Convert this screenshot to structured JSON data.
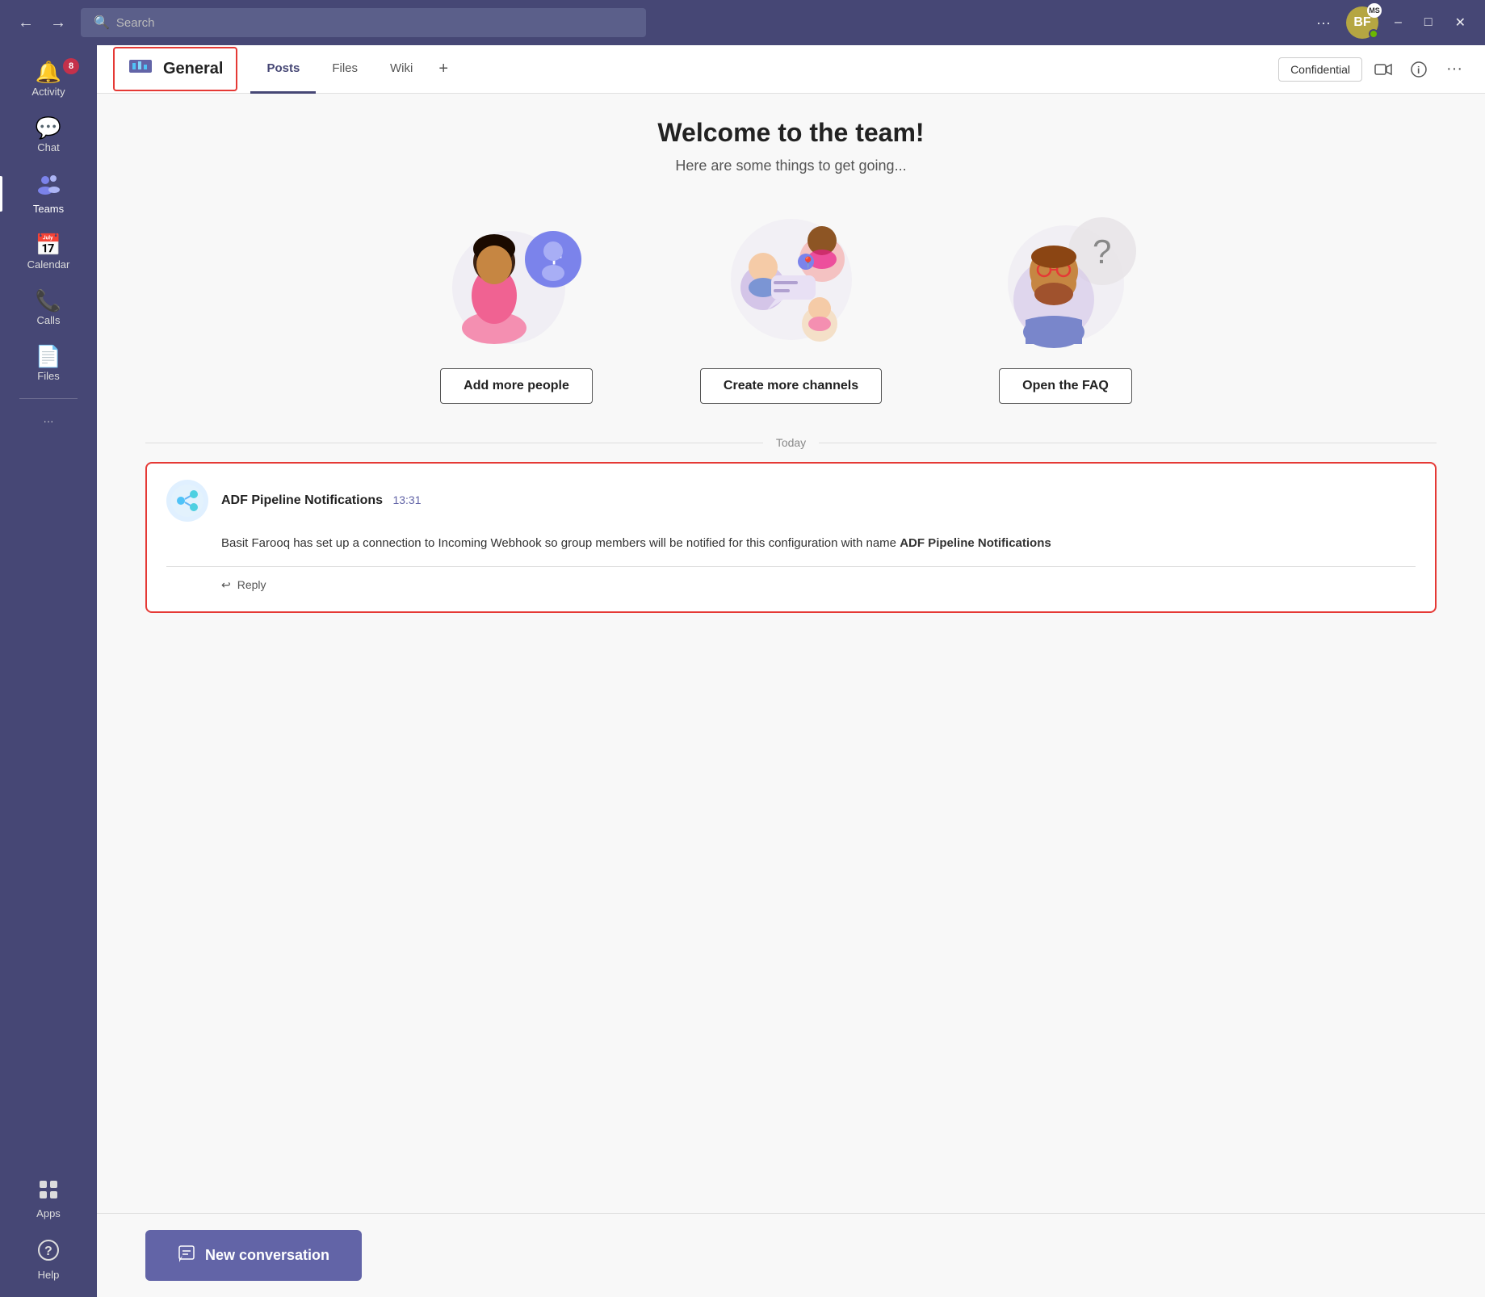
{
  "titleBar": {
    "search_placeholder": "Search",
    "back_label": "←",
    "forward_label": "→",
    "more_label": "···",
    "avatar_initials": "BF",
    "ms_badge": "MS",
    "minimize_label": "–",
    "maximize_label": "□",
    "close_label": "✕"
  },
  "sidebar": {
    "items": [
      {
        "id": "activity",
        "label": "Activity",
        "icon": "🔔",
        "badge": "8",
        "active": false
      },
      {
        "id": "chat",
        "label": "Chat",
        "icon": "💬",
        "badge": null,
        "active": false
      },
      {
        "id": "teams",
        "label": "Teams",
        "icon": "👥",
        "badge": null,
        "active": true
      },
      {
        "id": "calendar",
        "label": "Calendar",
        "icon": "📅",
        "badge": null,
        "active": false
      },
      {
        "id": "calls",
        "label": "Calls",
        "icon": "📞",
        "badge": null,
        "active": false
      },
      {
        "id": "files",
        "label": "Files",
        "icon": "📄",
        "badge": null,
        "active": false
      },
      {
        "id": "more",
        "label": "···",
        "icon": "···",
        "badge": null,
        "active": false
      }
    ],
    "bottom_items": [
      {
        "id": "apps",
        "label": "Apps",
        "icon": "⊞"
      },
      {
        "id": "help",
        "label": "Help",
        "icon": "?"
      }
    ]
  },
  "channel": {
    "name": "General",
    "icon": "📊",
    "tabs": [
      {
        "label": "Posts",
        "active": true
      },
      {
        "label": "Files",
        "active": false
      },
      {
        "label": "Wiki",
        "active": false
      }
    ],
    "add_tab_label": "+",
    "confidential_label": "Confidential",
    "video_icon": "🎥",
    "info_icon": "ℹ",
    "more_icon": "···"
  },
  "welcome": {
    "title": "Welcome to the team!",
    "subtitle": "Here are some things to get going...",
    "cards": [
      {
        "id": "add-people",
        "btn_label": "Add more people"
      },
      {
        "id": "create-channels",
        "btn_label": "Create more channels"
      },
      {
        "id": "faq",
        "btn_label": "Open the FAQ"
      }
    ]
  },
  "feed": {
    "today_label": "Today",
    "message": {
      "sender": "ADF Pipeline Notifications",
      "time": "13:31",
      "body_text": "Basit Farooq has set up a connection to Incoming Webhook so group members will be notified for this configuration with name ",
      "body_bold": "ADF Pipeline Notifications",
      "reply_label": "Reply",
      "reply_icon": "↩"
    }
  },
  "newConversation": {
    "label": "New conversation",
    "icon": "✎"
  }
}
